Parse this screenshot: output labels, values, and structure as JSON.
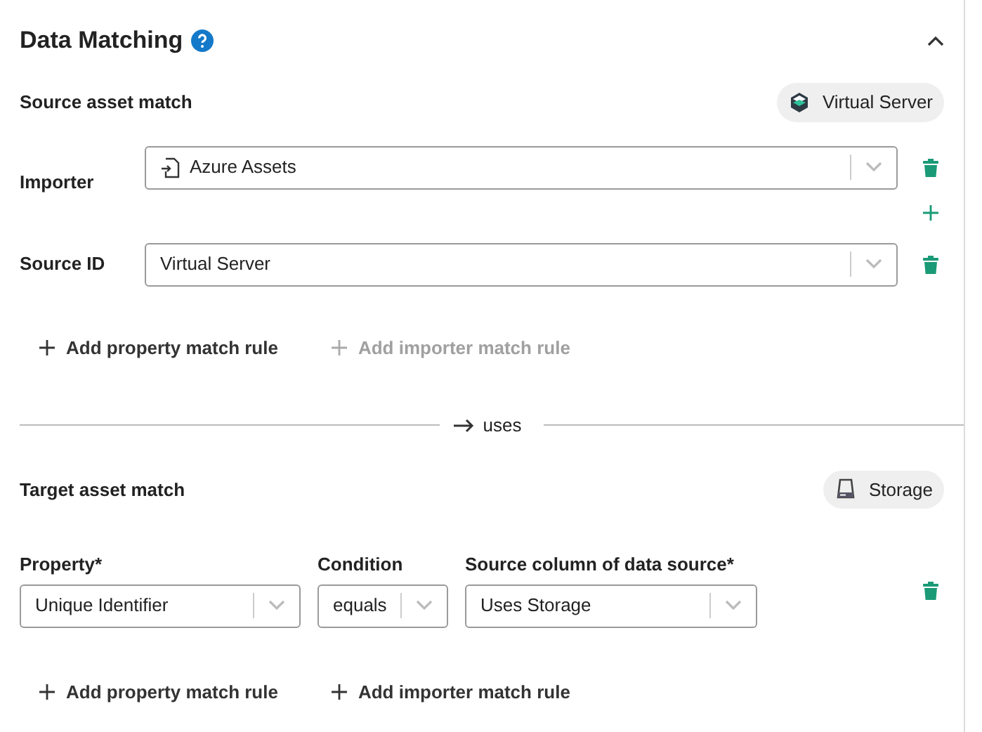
{
  "title": "Data Matching",
  "expanded": true,
  "source": {
    "heading": "Source asset match",
    "chip": {
      "label": "Virtual Server",
      "kind": "server"
    },
    "rows": [
      {
        "label": "Importer",
        "value": "Azure Assets",
        "kind": "importer",
        "can_add": true
      },
      {
        "label": "Source ID",
        "value": "Virtual Server",
        "can_add": false
      }
    ],
    "add_buttons": [
      {
        "label": "Add property match rule",
        "disabled": false
      },
      {
        "label": "Add importer match rule",
        "disabled": true
      }
    ]
  },
  "divider": "uses",
  "target": {
    "heading": "Target asset match",
    "chip": {
      "label": "Storage",
      "kind": "storage"
    },
    "fields": [
      {
        "label": "Property*",
        "value": "Unique Identifier"
      },
      {
        "label": "Condition",
        "value": "equals"
      },
      {
        "label": "Source column of data source*",
        "value": "Uses Storage"
      }
    ],
    "add_buttons": [
      {
        "label": "Add property match rule",
        "disabled": false
      },
      {
        "label": "Add importer match rule",
        "disabled": false
      }
    ]
  }
}
